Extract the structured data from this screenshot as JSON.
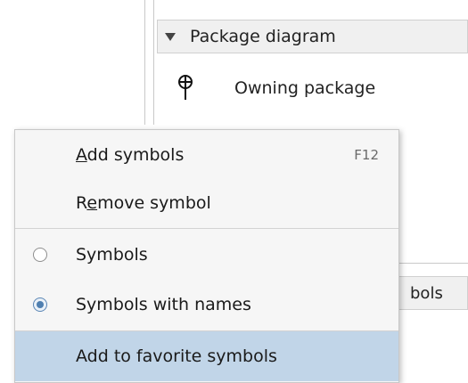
{
  "panel": {
    "section_title": "Package diagram",
    "owning_package": {
      "label": "Owning package",
      "icon": "owning-package-icon"
    },
    "partial_header_text": "bols"
  },
  "menu": {
    "add_symbols": {
      "prefix": "",
      "mnemonic": "A",
      "rest": "dd symbols",
      "shortcut": "F12"
    },
    "remove_symbol": {
      "prefix": "R",
      "mnemonic": "e",
      "rest": "move symbol"
    },
    "symbols": {
      "label": "Symbols",
      "checked": false
    },
    "symbols_with_names": {
      "label": "Symbols with names",
      "checked": true
    },
    "add_to_favorites": {
      "label": "Add to favorite symbols"
    }
  },
  "colors": {
    "highlight": "#c1d5e8",
    "menu_background": "#f6f6f6",
    "radio_selected": "#4f7fb0"
  }
}
